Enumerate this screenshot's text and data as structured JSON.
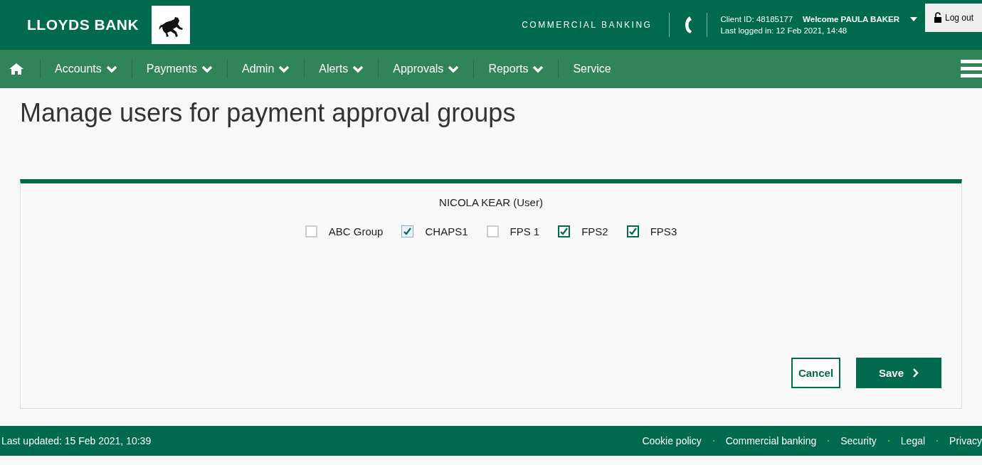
{
  "header": {
    "brand": "LLOYDS BANK",
    "section": "COMMERCIAL BANKING",
    "client_id": "Client ID: 48185177",
    "welcome": "Welcome PAULA BAKER",
    "last_logged": "Last logged in: 12 Feb 2021, 14:48",
    "logout": "Log out"
  },
  "nav": [
    {
      "label": "Accounts",
      "dropdown": true
    },
    {
      "label": "Payments",
      "dropdown": true
    },
    {
      "label": "Admin",
      "dropdown": true
    },
    {
      "label": "Alerts",
      "dropdown": true
    },
    {
      "label": "Approvals",
      "dropdown": true
    },
    {
      "label": "Reports",
      "dropdown": true
    },
    {
      "label": "Service",
      "dropdown": false
    }
  ],
  "page_title": "Manage users for payment approval groups",
  "panel": {
    "user": "NICOLA KEAR (User)",
    "groups": [
      {
        "label": "ABC Group",
        "checked": false,
        "focused": false
      },
      {
        "label": "CHAPS1",
        "checked": true,
        "focused": true
      },
      {
        "label": "FPS 1",
        "checked": false,
        "focused": false
      },
      {
        "label": "FPS2",
        "checked": true,
        "focused": false
      },
      {
        "label": "FPS3",
        "checked": true,
        "focused": false
      }
    ],
    "buttons": [
      {
        "label": "Cancel",
        "kind": "secondary"
      },
      {
        "label": "Save",
        "kind": "primary"
      }
    ]
  },
  "footer": {
    "updated": "Last updated: 15 Feb 2021, 10:39",
    "links": [
      "Cookie policy",
      "Commercial banking",
      "Security",
      "Legal",
      "Privacy"
    ]
  }
}
